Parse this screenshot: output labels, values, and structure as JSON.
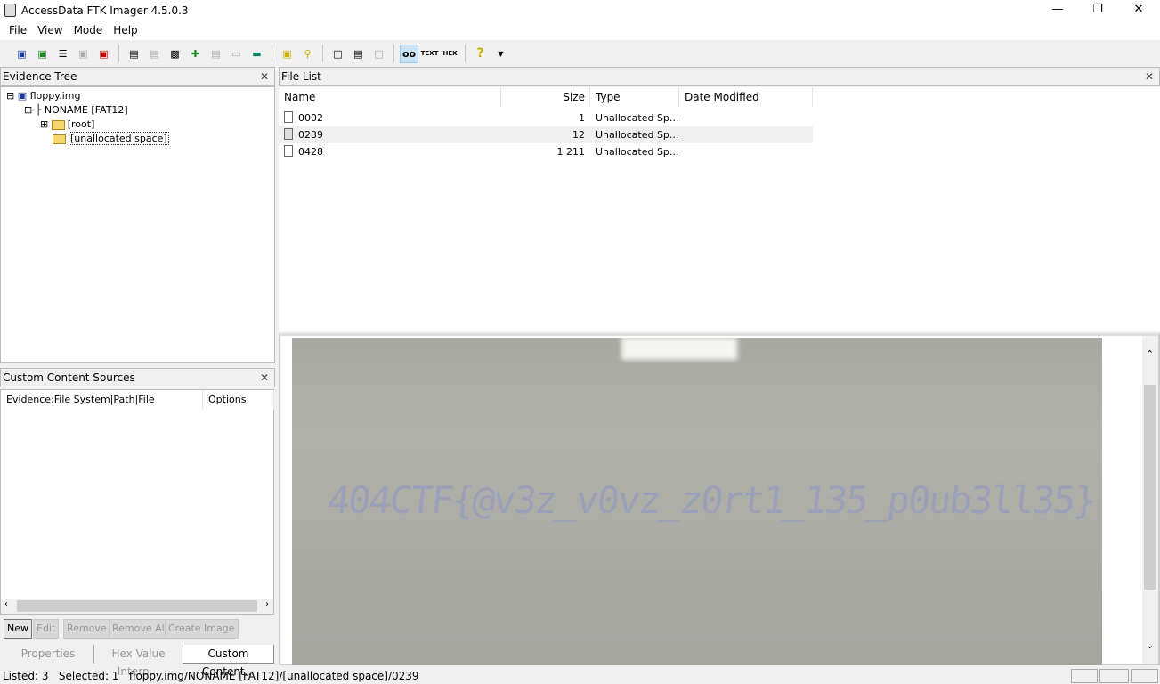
{
  "app": {
    "title": "AccessData FTK Imager 4.5.0.3"
  },
  "menu": [
    "File",
    "View",
    "Mode",
    "Help"
  ],
  "toolbar": {
    "icons": [
      "add-evidence-icon",
      "add-all-evidence-icon",
      "image-mounting-icon",
      "remove-evidence-icon",
      "remove-all-evidence-icon",
      "create-disk-image-icon",
      "export-disk-image-icon",
      "capture-memory-icon",
      "obtain-protected-files-icon",
      "detect-encryption-icon",
      "verify-drive-icon",
      "ram-icon",
      "evidence-tree-icon",
      "decrypt-key-icon",
      "export-files-icon",
      "export-file-hash-icon",
      "export-directory-listing-icon",
      "automatic-view-icon",
      "text-view-icon",
      "hex-view-icon",
      "help-icon"
    ],
    "text_label": "TEXT",
    "hex_label": "HEX"
  },
  "evidence_tree": {
    "title": "Evidence Tree",
    "items": [
      {
        "label": "floppy.img"
      },
      {
        "label": "NONAME [FAT12]"
      },
      {
        "label": "[root]"
      },
      {
        "label": "[unallocated space]"
      }
    ]
  },
  "file_list": {
    "title": "File List",
    "columns": [
      "Name",
      "Size",
      "Type",
      "Date Modified"
    ],
    "rows": [
      {
        "name": "0002",
        "size": "1",
        "type": "Unallocated Sp...",
        "date": ""
      },
      {
        "name": "0239",
        "size": "12",
        "type": "Unallocated Sp...",
        "date": ""
      },
      {
        "name": "0428",
        "size": "1 211",
        "type": "Unallocated Sp...",
        "date": ""
      }
    ]
  },
  "viewer": {
    "handwritten_text": "404CTF{@v3z_v0vz_z0rt1_135_p0ub3ll35}"
  },
  "custom_content": {
    "title": "Custom Content Sources",
    "columns": [
      "Evidence:File System|Path|File",
      "Options"
    ],
    "buttons": [
      "New",
      "Edit",
      "Remove",
      "Remove All",
      "Create Image"
    ]
  },
  "bottom_tabs": [
    "Properties",
    "Hex Value Interp...",
    "Custom Content..."
  ],
  "status": {
    "listed": "Listed: 3",
    "selected": "Selected: 1",
    "path": "floppy.img/NONAME [FAT12]/[unallocated space]/0239"
  }
}
